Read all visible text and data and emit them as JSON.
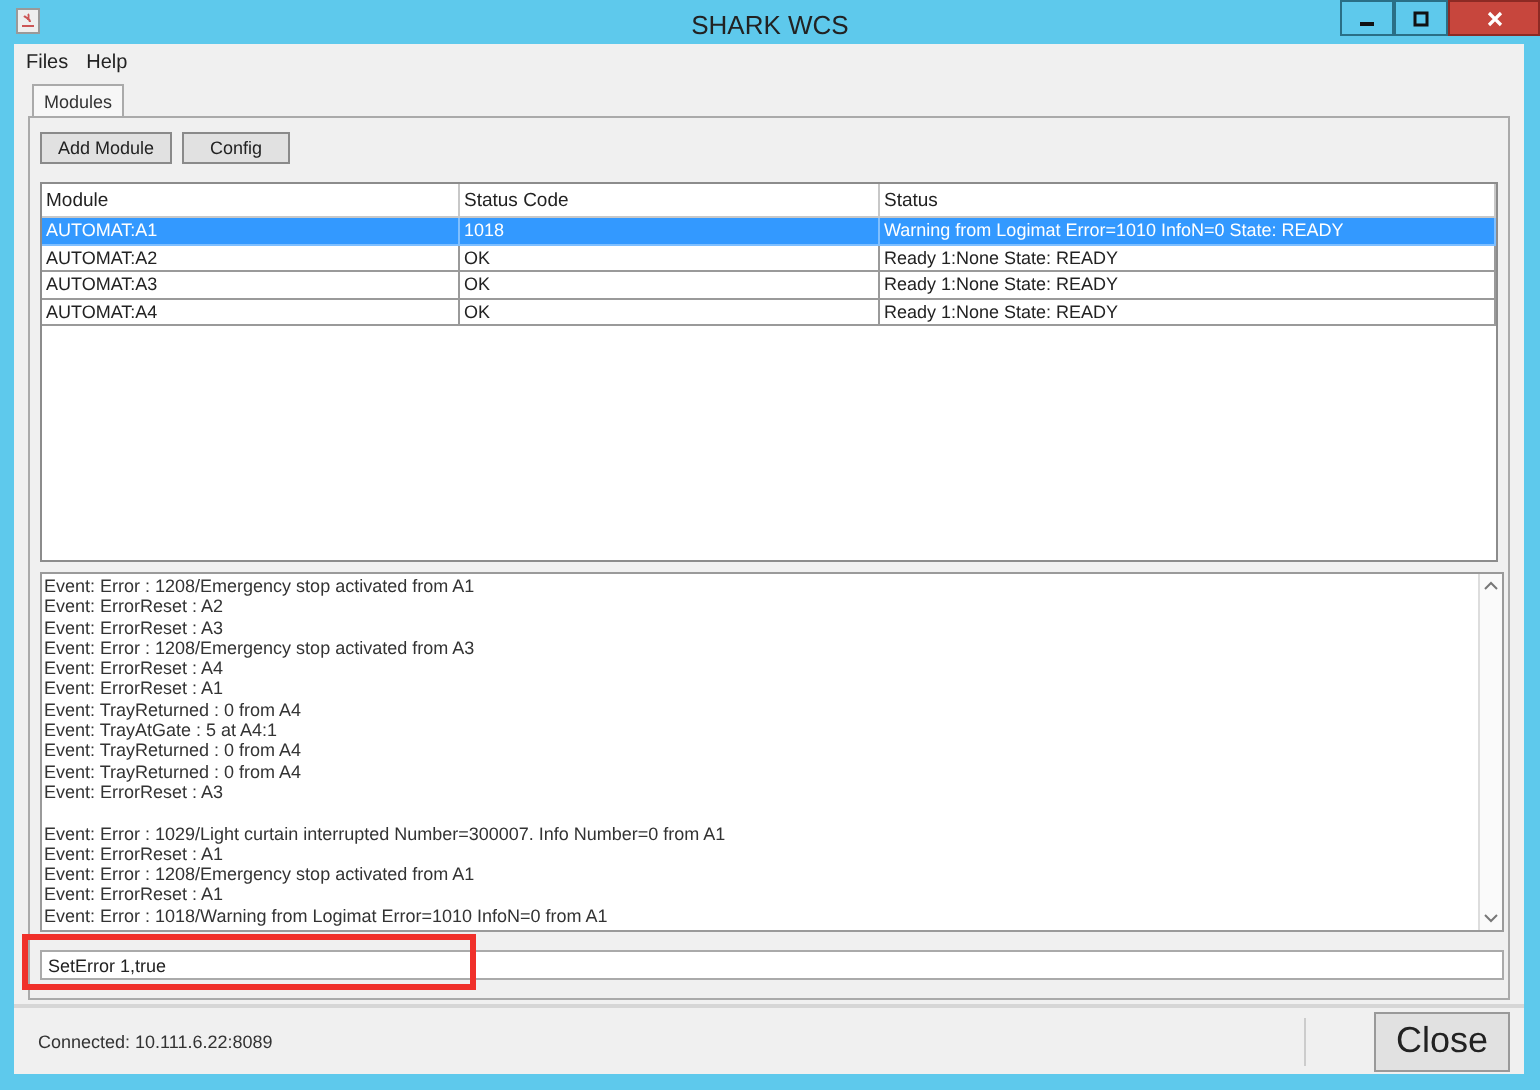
{
  "window": {
    "title": "SHARK WCS"
  },
  "menu": [
    "Files",
    "Help"
  ],
  "tabs": [
    {
      "label": "Modules",
      "selected": true
    }
  ],
  "toolbar": [
    "Add Module",
    "Config"
  ],
  "table": {
    "columns": [
      "Module",
      "Status Code",
      "Status"
    ],
    "rows": [
      {
        "cells": [
          "AUTOMAT:A1",
          "1018",
          "Warning from Logimat Error=1010 InfoN=0 State: READY"
        ],
        "selected": true
      },
      {
        "cells": [
          "AUTOMAT:A2",
          "OK",
          "Ready  1:None State: READY"
        ],
        "selected": false
      },
      {
        "cells": [
          "AUTOMAT:A3",
          "OK",
          "Ready  1:None State: READY"
        ],
        "selected": false
      },
      {
        "cells": [
          "AUTOMAT:A4",
          "OK",
          "Ready  1:None State: READY"
        ],
        "selected": false
      }
    ]
  },
  "log_blocks": [
    {
      "lines": [
        "Event: Error : 1208/Emergency stop activated from A1",
        "Event: ErrorReset : A2",
        "Event: ErrorReset : A3",
        "Event: Error : 1208/Emergency stop activated from A3",
        "Event: ErrorReset : A4",
        "Event: ErrorReset : A1",
        "Event: TrayReturned : 0 from A4",
        "Event: TrayAtGate : 5 at A4:1",
        "Event: TrayReturned : 0 from A4",
        "Event: TrayReturned : 0 from A4",
        "Event: ErrorReset : A3"
      ]
    },
    {
      "lines": [
        "Event: Error : 1029/Light curtain interrupted Number=300007. Info Number=0 from A1",
        "Event: ErrorReset : A1",
        "Event: Error : 1208/Emergency stop activated from A1",
        "Event: ErrorReset : A1",
        "Event: Error : 1018/Warning from Logimat Error=1010 InfoN=0 from A1"
      ]
    }
  ],
  "command": {
    "value": "SetError 1,true",
    "highlighted": true
  },
  "status": "Connected: 10.111.6.22:8089",
  "close_button": "Close"
}
